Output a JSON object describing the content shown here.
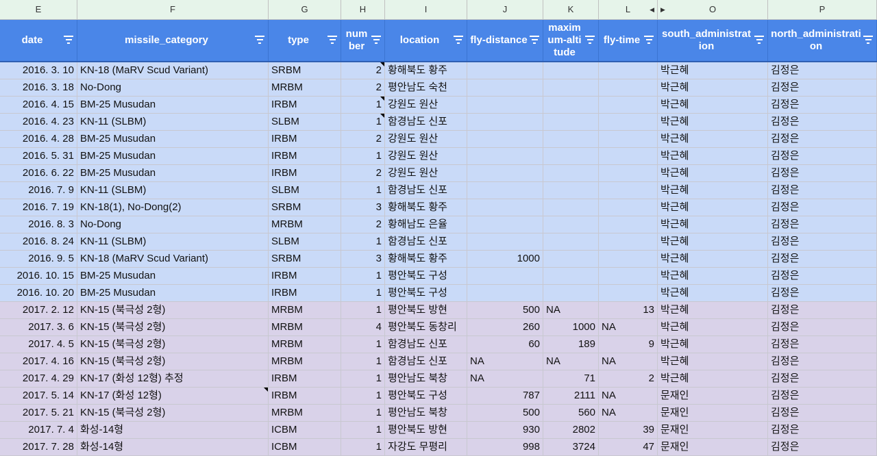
{
  "column_letters": [
    "E",
    "F",
    "G",
    "H",
    "I",
    "J",
    "K",
    "L",
    "O",
    "P"
  ],
  "headers": [
    {
      "key": "date",
      "label": "date"
    },
    {
      "key": "missile_category",
      "label": "missile_category"
    },
    {
      "key": "type",
      "label": "type"
    },
    {
      "key": "number",
      "label": "number"
    },
    {
      "key": "location",
      "label": "location"
    },
    {
      "key": "fly_distance",
      "label": "fly-distance"
    },
    {
      "key": "maximum_altitude",
      "label": "maximum-altitude"
    },
    {
      "key": "fly_time",
      "label": "fly-time"
    },
    {
      "key": "south_administration",
      "label": "south_administration"
    },
    {
      "key": "north_administration",
      "label": "north_administration"
    }
  ],
  "rows": [
    {
      "year": "2016",
      "date": "2016. 3. 10",
      "missile_category": "KN-18 (MaRV Scud Variant)",
      "type": "SRBM",
      "number": "2",
      "location": "황해북도 황주",
      "fly_distance": "",
      "maximum_altitude": "",
      "fly_time": "",
      "south": "박근혜",
      "north": "김정은",
      "note": true
    },
    {
      "year": "2016",
      "date": "2016. 3. 18",
      "missile_category": "No-Dong",
      "type": "MRBM",
      "number": "2",
      "location": "평안남도 숙천",
      "fly_distance": "",
      "maximum_altitude": "",
      "fly_time": "",
      "south": "박근혜",
      "north": "김정은",
      "note": false
    },
    {
      "year": "2016",
      "date": "2016. 4. 15",
      "missile_category": "BM-25 Musudan",
      "type": "IRBM",
      "number": "1",
      "location": "강원도 원산",
      "fly_distance": "",
      "maximum_altitude": "",
      "fly_time": "",
      "south": "박근혜",
      "north": "김정은",
      "note": true
    },
    {
      "year": "2016",
      "date": "2016. 4. 23",
      "missile_category": "KN-11 (SLBM)",
      "type": "SLBM",
      "number": "1",
      "location": "함경남도 신포",
      "fly_distance": "",
      "maximum_altitude": "",
      "fly_time": "",
      "south": "박근혜",
      "north": "김정은",
      "note": true
    },
    {
      "year": "2016",
      "date": "2016. 4. 28",
      "missile_category": "BM-25 Musudan",
      "type": "IRBM",
      "number": "2",
      "location": "강원도 원산",
      "fly_distance": "",
      "maximum_altitude": "",
      "fly_time": "",
      "south": "박근혜",
      "north": "김정은",
      "note": false
    },
    {
      "year": "2016",
      "date": "2016. 5. 31",
      "missile_category": "BM-25 Musudan",
      "type": "IRBM",
      "number": "1",
      "location": "강원도 원산",
      "fly_distance": "",
      "maximum_altitude": "",
      "fly_time": "",
      "south": "박근혜",
      "north": "김정은",
      "note": false
    },
    {
      "year": "2016",
      "date": "2016. 6. 22",
      "missile_category": "BM-25 Musudan",
      "type": "IRBM",
      "number": "2",
      "location": "강원도 원산",
      "fly_distance": "",
      "maximum_altitude": "",
      "fly_time": "",
      "south": "박근혜",
      "north": "김정은",
      "note": false
    },
    {
      "year": "2016",
      "date": "2016. 7. 9",
      "missile_category": "KN-11 (SLBM)",
      "type": "SLBM",
      "number": "1",
      "location": "함경남도 신포",
      "fly_distance": "",
      "maximum_altitude": "",
      "fly_time": "",
      "south": "박근혜",
      "north": "김정은",
      "note": false
    },
    {
      "year": "2016",
      "date": "2016. 7. 19",
      "missile_category": "KN-18(1), No-Dong(2)",
      "type": "SRBM",
      "number": "3",
      "location": "황해북도 황주",
      "fly_distance": "",
      "maximum_altitude": "",
      "fly_time": "",
      "south": "박근혜",
      "north": "김정은",
      "note": false
    },
    {
      "year": "2016",
      "date": "2016. 8. 3",
      "missile_category": "No-Dong",
      "type": "MRBM",
      "number": "2",
      "location": "황해남도 은율",
      "fly_distance": "",
      "maximum_altitude": "",
      "fly_time": "",
      "south": "박근혜",
      "north": "김정은",
      "note": false
    },
    {
      "year": "2016",
      "date": "2016. 8. 24",
      "missile_category": "KN-11 (SLBM)",
      "type": "SLBM",
      "number": "1",
      "location": "함경남도 신포",
      "fly_distance": "",
      "maximum_altitude": "",
      "fly_time": "",
      "south": "박근혜",
      "north": "김정은",
      "note": false
    },
    {
      "year": "2016",
      "date": "2016. 9. 5",
      "missile_category": "KN-18 (MaRV Scud Variant)",
      "type": "SRBM",
      "number": "3",
      "location": "황해북도 황주",
      "fly_distance": "1000",
      "maximum_altitude": "",
      "fly_time": "",
      "south": "박근혜",
      "north": "김정은",
      "note": false
    },
    {
      "year": "2016",
      "date": "2016. 10. 15",
      "missile_category": "BM-25 Musudan",
      "type": "IRBM",
      "number": "1",
      "location": "평안북도 구성",
      "fly_distance": "",
      "maximum_altitude": "",
      "fly_time": "",
      "south": "박근혜",
      "north": "김정은",
      "note": false
    },
    {
      "year": "2016",
      "date": "2016. 10. 20",
      "missile_category": "BM-25 Musudan",
      "type": "IRBM",
      "number": "1",
      "location": "평안북도 구성",
      "fly_distance": "",
      "maximum_altitude": "",
      "fly_time": "",
      "south": "박근혜",
      "north": "김정은",
      "note": false
    },
    {
      "year": "2017",
      "date": "2017. 2. 12",
      "missile_category": "KN-15 (북극성 2형)",
      "type": "MRBM",
      "number": "1",
      "location": "평안북도 방현",
      "fly_distance": "500",
      "maximum_altitude": "NA",
      "fly_time": "13",
      "south": "박근혜",
      "north": "김정은",
      "note": false
    },
    {
      "year": "2017",
      "date": "2017. 3. 6",
      "missile_category": "KN-15 (북극성 2형)",
      "type": "MRBM",
      "number": "4",
      "location": "평안북도 동창리",
      "fly_distance": "260",
      "maximum_altitude": "1000",
      "fly_time": "NA",
      "south": "박근혜",
      "north": "김정은",
      "note": false
    },
    {
      "year": "2017",
      "date": "2017. 4. 5",
      "missile_category": "KN-15 (북극성 2형)",
      "type": "MRBM",
      "number": "1",
      "location": "함경남도 신포",
      "fly_distance": "60",
      "maximum_altitude": "189",
      "fly_time": "9",
      "south": "박근혜",
      "north": "김정은",
      "note": false
    },
    {
      "year": "2017",
      "date": "2017. 4. 16",
      "missile_category": "KN-15 (북극성 2형)",
      "type": "MRBM",
      "number": "1",
      "location": "함경남도 신포",
      "fly_distance": "NA",
      "maximum_altitude": "NA",
      "fly_time": "NA",
      "south": "박근혜",
      "north": "김정은",
      "note": false
    },
    {
      "year": "2017",
      "date": "2017. 4. 29",
      "missile_category": "KN-17 (화성 12형) 추정",
      "type": "IRBM",
      "number": "1",
      "location": "평안남도 북창",
      "fly_distance": "NA",
      "maximum_altitude": "71",
      "fly_time": "2",
      "south": "박근혜",
      "north": "김정은",
      "note": false
    },
    {
      "year": "2017",
      "date": "2017. 5. 14",
      "missile_category": "KN-17 (화성 12형)",
      "type": "IRBM",
      "number": "1",
      "location": "평안북도 구성",
      "fly_distance": "787",
      "maximum_altitude": "2111",
      "fly_time": "NA",
      "south": "문재인",
      "north": "김정은",
      "note": false,
      "cat_note": true
    },
    {
      "year": "2017",
      "date": "2017. 5. 21",
      "missile_category": "KN-15 (북극성 2형)",
      "type": "MRBM",
      "number": "1",
      "location": "평안남도 북창",
      "fly_distance": "500",
      "maximum_altitude": "560",
      "fly_time": "NA",
      "south": "문재인",
      "north": "김정은",
      "note": false
    },
    {
      "year": "2017",
      "date": "2017. 7. 4",
      "missile_category": "화성-14형",
      "type": "ICBM",
      "number": "1",
      "location": "평안북도 방현",
      "fly_distance": "930",
      "maximum_altitude": "2802",
      "fly_time": "39",
      "south": "문재인",
      "north": "김정은",
      "note": false
    },
    {
      "year": "2017",
      "date": "2017. 7. 28",
      "missile_category": "화성-14형",
      "type": "ICBM",
      "number": "1",
      "location": "자강도 무평리",
      "fly_distance": "998",
      "maximum_altitude": "3724",
      "fly_time": "47",
      "south": "문재인",
      "north": "김정은",
      "note": false
    }
  ],
  "colors": {
    "header_bg": "#4a86e8",
    "row_2016": "#c9daf8",
    "row_2017": "#d9d2e9",
    "letter_bar": "#f1f3f4"
  }
}
